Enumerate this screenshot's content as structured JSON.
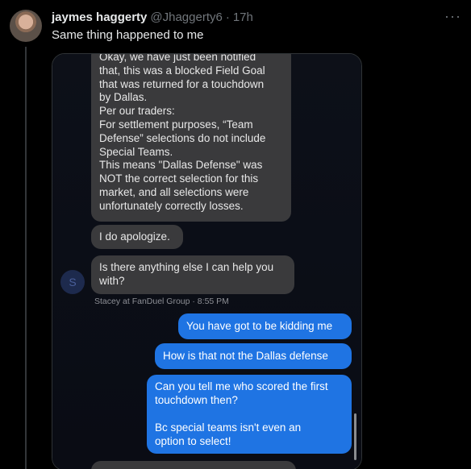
{
  "tweet": {
    "display_name": "jaymes haggerty",
    "handle": "@Jhaggerty6",
    "separator": "·",
    "time": "17h",
    "more_label": "···",
    "text": "Same thing happened to me"
  },
  "screenshot": {
    "messages": [
      {
        "from": "agent",
        "text": "Okay, we have just been notified\nthat, this was a blocked Field Goal\nthat was returned for a touchdown\nby Dallas.\nPer our traders:\nFor settlement purposes, “Team\nDefense” selections do not include\nSpecial Teams.\nThis means \"Dallas Defense\" was\nNOT the correct selection for this\nmarket, and all selections were\nunfortunately correctly losses."
      },
      {
        "from": "agent",
        "text": "I do apologize."
      },
      {
        "from": "agent",
        "text": "Is there anything else I can help you\nwith?"
      },
      {
        "from": "user",
        "text": "You have got to be kidding me"
      },
      {
        "from": "user",
        "text": "How is that not the Dallas defense"
      },
      {
        "from": "user",
        "text": "Can you tell me who scored the first\ntouchdown then?\n\nBc special teams isn't even an\noption to select!"
      }
    ],
    "agent_avatar_letter": "S",
    "agent_meta": "Stacey at FanDuel Group · 8:55 PM"
  },
  "colors": {
    "background": "#000000",
    "agent_bubble": "#3a3a3c",
    "user_bubble": "#1f74e3",
    "secondary_text": "#71767b"
  }
}
